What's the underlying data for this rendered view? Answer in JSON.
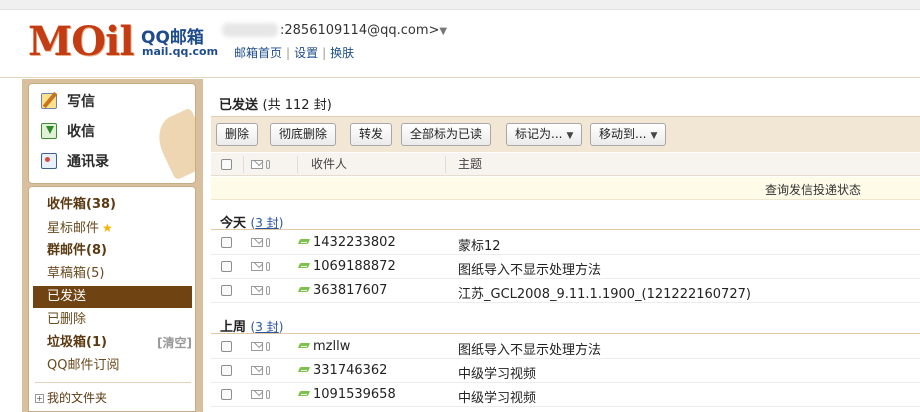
{
  "header": {
    "logo_text": "MOil",
    "product_name": "QQ邮箱",
    "domain": "mail.qq.com",
    "account": ":2856109114@qq.com>",
    "links": [
      "邮箱首页",
      "设置",
      "换肤"
    ]
  },
  "quick_actions": [
    {
      "label": "写信",
      "icon": "compose-icon"
    },
    {
      "label": "收信",
      "icon": "inbox-download-icon"
    },
    {
      "label": "通讯录",
      "icon": "contacts-icon"
    }
  ],
  "folders": [
    {
      "label": "收件箱(38)",
      "bold": true
    },
    {
      "label": "星标邮件",
      "star": true
    },
    {
      "label": "群邮件(8)",
      "bold": true
    },
    {
      "label": "草稿箱(5)"
    },
    {
      "label": "已发送",
      "active": true
    },
    {
      "label": "已删除"
    },
    {
      "label": "垃圾箱(1)",
      "bold": true,
      "action": "[清空]"
    },
    {
      "label": "QQ邮件订阅"
    }
  ],
  "my_folders": "我的文件夹",
  "main": {
    "title": "已发送",
    "count_text": "(共 112 封)",
    "toolbar": {
      "delete": "删除",
      "delete_permanently": "彻底删除",
      "forward": "转发",
      "mark_all_read": "全部标为已读",
      "mark_as": "标记为...",
      "move_to": "移动到..."
    },
    "columns": {
      "recipient": "收件人",
      "subject": "主题"
    },
    "notice": "查询发信投递状态",
    "groups": [
      {
        "title": "今天",
        "count": "3 封",
        "rows": [
          {
            "recipient": "1432233802",
            "subject": "蒙标12"
          },
          {
            "recipient": "1069188872",
            "subject": "图纸导入不显示处理方法"
          },
          {
            "recipient": "363817607",
            "subject": "江苏_GCL2008_9.11.1.1900_(121222160727)"
          }
        ]
      },
      {
        "title": "上周",
        "count": "3 封",
        "rows": [
          {
            "recipient": "mzllw",
            "subject": "图纸导入不显示处理方法"
          },
          {
            "recipient": "331746362",
            "subject": "中级学习视频"
          },
          {
            "recipient": "1091539658",
            "subject": "中级学习视频"
          }
        ]
      }
    ]
  },
  "colors": {
    "brand_red": "#c43d12",
    "brand_blue": "#1e4c8c",
    "sidebar_tan": "#d8c09f",
    "active_brown": "#6f4412"
  }
}
